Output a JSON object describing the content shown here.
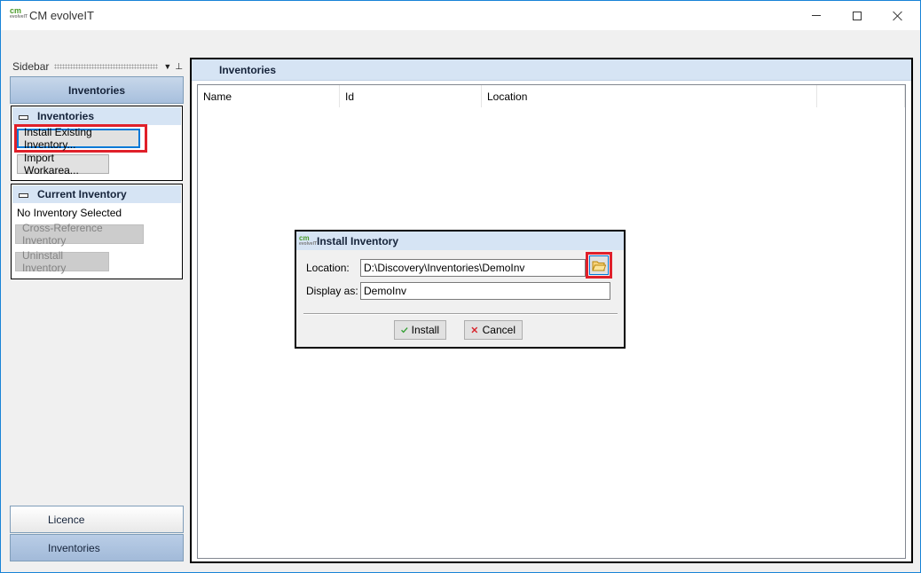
{
  "window": {
    "title": "CM evolveIT",
    "logo_text": "cm",
    "logo_sub": "evolveIT"
  },
  "sidebar": {
    "label": "Sidebar",
    "header": "Inventories",
    "groups": [
      {
        "title": "Inventories",
        "buttons": [
          {
            "label": "Install Existing Inventory..."
          },
          {
            "label": "Import Workarea..."
          }
        ]
      },
      {
        "title": "Current Inventory",
        "status": "No Inventory Selected",
        "buttons": [
          {
            "label": "Cross-Reference Inventory"
          },
          {
            "label": "Uninstall Inventory"
          }
        ]
      }
    ],
    "bottom_tabs": [
      {
        "label": "Licence"
      },
      {
        "label": "Inventories"
      }
    ]
  },
  "main": {
    "title": "Inventories",
    "columns": [
      "Name",
      "Id",
      "Location"
    ]
  },
  "dialog": {
    "title": "Install Inventory",
    "location_label": "Location:",
    "location_value": "D:\\Discovery\\Inventories\\DemoInv",
    "display_label": "Display as:",
    "display_value": "DemoInv",
    "install_label": "Install",
    "cancel_label": "Cancel"
  },
  "colors": {
    "header_blue": "#d6e4f4",
    "highlight_red": "#e0202a",
    "accent_blue": "#0078d7"
  }
}
